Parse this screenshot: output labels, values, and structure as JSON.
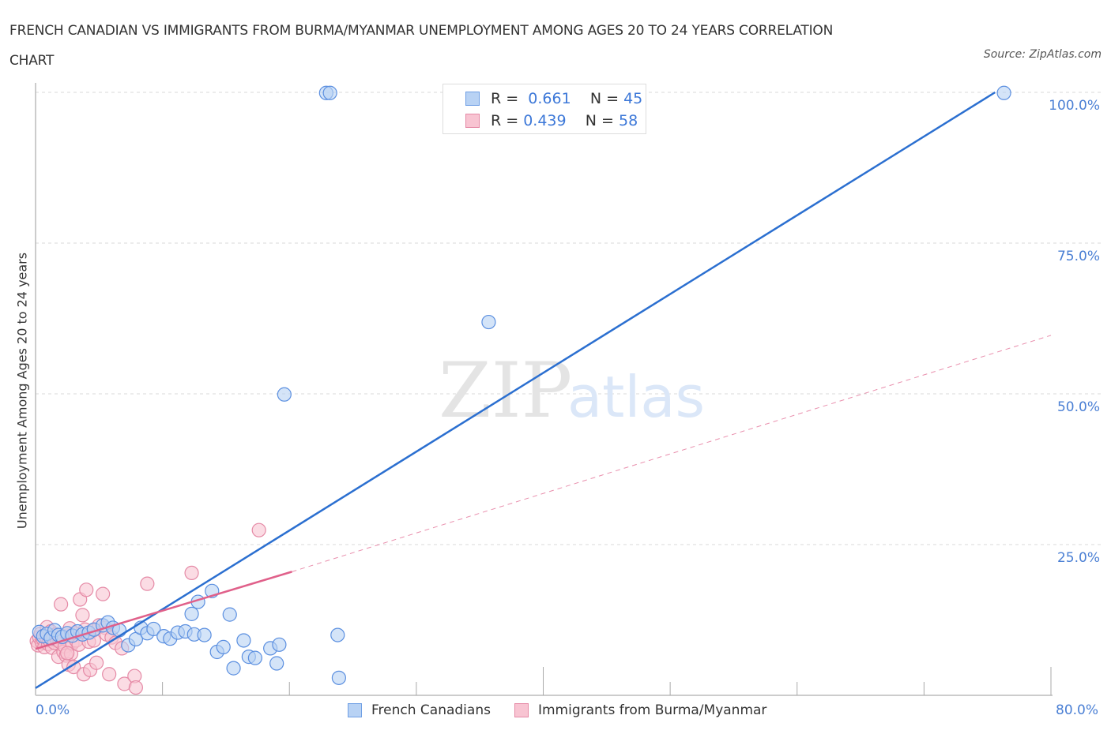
{
  "title_line1": "FRENCH CANADIAN VS IMMIGRANTS FROM BURMA/MYANMAR UNEMPLOYMENT AMONG AGES 20 TO 24 YEARS CORRELATION",
  "title_line2": "CHART",
  "source": "Source: ZipAtlas.com",
  "watermark": {
    "zip": "ZIP",
    "atlas": "atlas"
  },
  "legend_top": [
    {
      "r_label": "R =",
      "r_value": "0.661",
      "n_label": "N =",
      "n_value": "45"
    },
    {
      "r_label": "R =",
      "r_value": "0.439",
      "n_label": "N =",
      "n_value": "58"
    }
  ],
  "colors": {
    "blue_fill": "#b8d2f4",
    "blue_stroke": "#5b8fe0",
    "blue_line": "#2b6fd0",
    "pink_fill": "#f8c4d2",
    "pink_stroke": "#e58aa6",
    "pink_line": "#e0608a",
    "tick_label": "#4a7fd4"
  },
  "chart_data": {
    "type": "scatter",
    "title": "FRENCH CANADIAN VS IMMIGRANTS FROM BURMA/MYANMAR UNEMPLOYMENT AMONG AGES 20 TO 24 YEARS CORRELATION CHART",
    "xlabel": "",
    "ylabel": "Unemployment Among Ages 20 to 24 years",
    "xlim": [
      0,
      80
    ],
    "ylim": [
      0,
      100
    ],
    "x_tick_labels": [
      "0.0%",
      "80.0%"
    ],
    "y_ticks": [
      25,
      50,
      75,
      100
    ],
    "y_tick_labels": [
      "25.0%",
      "50.0%",
      "75.0%",
      "100.0%"
    ],
    "grid": true,
    "legend_position": "top-center",
    "series": [
      {
        "name": "French Canadians",
        "R": 0.661,
        "N": 45,
        "trend": {
          "x0": 0,
          "y0": 1.2,
          "x1": 75.6,
          "y1": 100
        },
        "points": [
          [
            0.3,
            10.5
          ],
          [
            0.6,
            9.8
          ],
          [
            0.9,
            10.2
          ],
          [
            1.2,
            9.5
          ],
          [
            1.5,
            10.8
          ],
          [
            1.8,
            10
          ],
          [
            2.1,
            9.7
          ],
          [
            2.5,
            10.3
          ],
          [
            2.9,
            9.9
          ],
          [
            3.3,
            10.6
          ],
          [
            3.7,
            10.1
          ],
          [
            4.2,
            10.4
          ],
          [
            4.6,
            10.9
          ],
          [
            5.3,
            11.6
          ],
          [
            5.7,
            12.1
          ],
          [
            6.1,
            11.2
          ],
          [
            6.6,
            10.8
          ],
          [
            7.3,
            8.3
          ],
          [
            7.9,
            9.3
          ],
          [
            8.3,
            11.2
          ],
          [
            8.8,
            10.3
          ],
          [
            9.3,
            11
          ],
          [
            10.1,
            9.8
          ],
          [
            10.6,
            9.4
          ],
          [
            11.2,
            10.4
          ],
          [
            11.8,
            10.6
          ],
          [
            12.3,
            13.5
          ],
          [
            12.5,
            10.1
          ],
          [
            13.3,
            10
          ],
          [
            12.8,
            15.5
          ],
          [
            13.9,
            17.3
          ],
          [
            14.3,
            7.2
          ],
          [
            14.8,
            8
          ],
          [
            15.3,
            13.4
          ],
          [
            15.6,
            4.5
          ],
          [
            16.4,
            9.1
          ],
          [
            16.8,
            6.4
          ],
          [
            17.3,
            6.2
          ],
          [
            18.5,
            7.8
          ],
          [
            19.2,
            8.4
          ],
          [
            19.0,
            5.3
          ],
          [
            19.6,
            49.9
          ],
          [
            22.9,
            99.9
          ],
          [
            23.2,
            99.9
          ],
          [
            23.8,
            10
          ],
          [
            23.9,
            2.9
          ],
          [
            35.7,
            61.9
          ],
          [
            76.3,
            99.9
          ]
        ]
      },
      {
        "name": "Immigrants from Burma/Myanmar",
        "R": 0.439,
        "N": 58,
        "trend": {
          "x0": 0,
          "y0": 7.7,
          "x1": 20.2,
          "y1": 20.5,
          "dashed_to_x": 80,
          "dashed_to_y": 59.7
        },
        "points": [
          [
            0.1,
            9
          ],
          [
            0.2,
            8.3
          ],
          [
            0.3,
            9.6
          ],
          [
            0.4,
            10.2
          ],
          [
            0.5,
            8.8
          ],
          [
            0.6,
            9.3
          ],
          [
            0.7,
            8
          ],
          [
            0.8,
            9.8
          ],
          [
            0.9,
            11.3
          ],
          [
            1.0,
            8.5
          ],
          [
            1.1,
            9.1
          ],
          [
            1.2,
            10.6
          ],
          [
            1.3,
            7.9
          ],
          [
            1.4,
            9.4
          ],
          [
            1.5,
            8.7
          ],
          [
            1.6,
            10.1
          ],
          [
            1.7,
            9.2
          ],
          [
            1.8,
            6.4
          ],
          [
            1.9,
            8.9
          ],
          [
            2.0,
            15.1
          ],
          [
            2.1,
            9.6
          ],
          [
            2.2,
            7.2
          ],
          [
            2.3,
            8.1
          ],
          [
            2.4,
            6.6
          ],
          [
            2.5,
            9.9
          ],
          [
            2.6,
            5.1
          ],
          [
            2.7,
            11.1
          ],
          [
            2.8,
            6.9
          ],
          [
            2.9,
            8.6
          ],
          [
            3.0,
            4.7
          ],
          [
            3.1,
            10.3
          ],
          [
            3.2,
            9.1
          ],
          [
            3.4,
            8.4
          ],
          [
            3.5,
            15.9
          ],
          [
            3.7,
            13.3
          ],
          [
            3.8,
            3.5
          ],
          [
            3.9,
            10.9
          ],
          [
            4.0,
            17.5
          ],
          [
            4.2,
            8.9
          ],
          [
            4.3,
            4.2
          ],
          [
            4.5,
            10.7
          ],
          [
            4.6,
            9.1
          ],
          [
            4.8,
            5.4
          ],
          [
            5.0,
            11.6
          ],
          [
            5.3,
            16.8
          ],
          [
            5.5,
            11.2
          ],
          [
            5.6,
            10.1
          ],
          [
            5.8,
            3.5
          ],
          [
            6.0,
            9.6
          ],
          [
            6.3,
            8.7
          ],
          [
            6.8,
            7.8
          ],
          [
            7.0,
            1.9
          ],
          [
            7.8,
            3.2
          ],
          [
            7.9,
            1.3
          ],
          [
            8.8,
            18.5
          ],
          [
            12.3,
            20.3
          ],
          [
            17.6,
            27.4
          ],
          [
            2.5,
            7.0
          ]
        ]
      }
    ]
  },
  "bottom_legend": [
    "French Canadians",
    "Immigrants from Burma/Myanmar"
  ]
}
